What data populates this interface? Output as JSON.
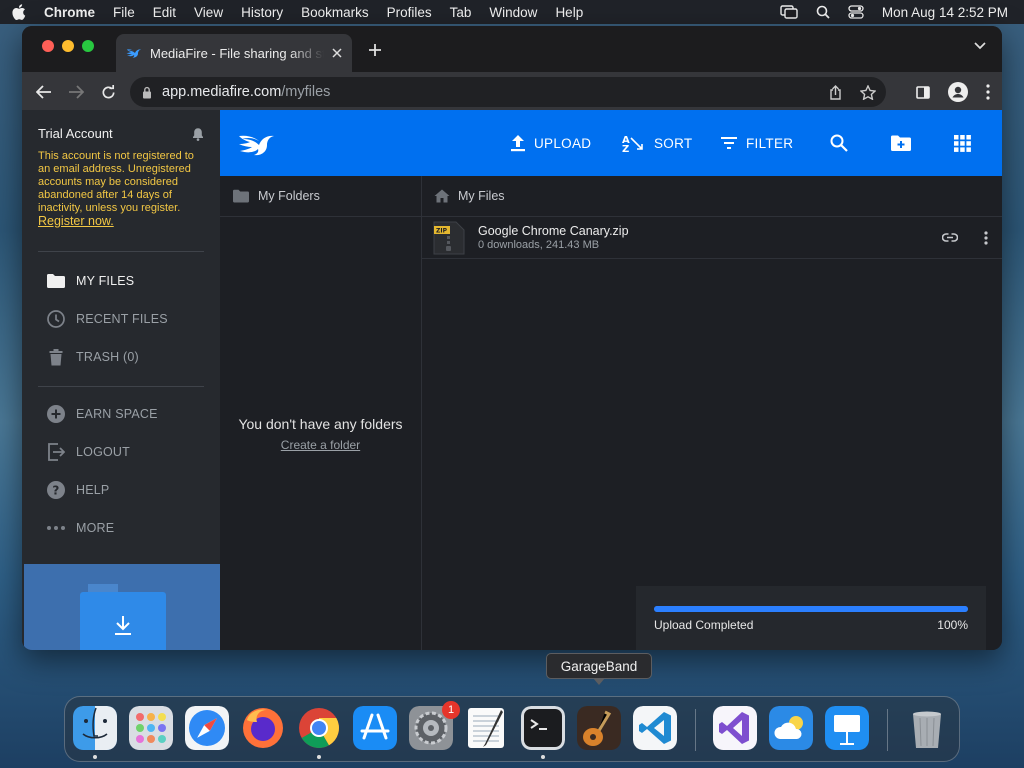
{
  "menubar": {
    "app": "Chrome",
    "items": [
      "File",
      "Edit",
      "View",
      "History",
      "Bookmarks",
      "Profiles",
      "Tab",
      "Window",
      "Help"
    ],
    "clock": "Mon Aug 14  2:52 PM"
  },
  "browser": {
    "tab_title": "MediaFire - File sharing and storage",
    "url_host": "app.mediafire.com",
    "url_path": "/myfiles"
  },
  "sidebar": {
    "account_title": "Trial Account",
    "warning": "This account is not registered to an email address. Unregistered accounts may be considered abandoned after 14 days of inactivity, unless you register.",
    "register_link": "Register now.",
    "items": [
      {
        "label": "MY FILES",
        "icon": "folder-icon"
      },
      {
        "label": "RECENT FILES",
        "icon": "clock-icon"
      },
      {
        "label": "TRASH (0)",
        "icon": "trash-icon"
      },
      {
        "label": "EARN SPACE",
        "icon": "plus-circle-icon"
      },
      {
        "label": "LOGOUT",
        "icon": "logout-icon"
      },
      {
        "label": "HELP",
        "icon": "help-icon"
      },
      {
        "label": "MORE",
        "icon": "more-icon"
      }
    ]
  },
  "header": {
    "upload": "UPLOAD",
    "sort": "SORT",
    "filter": "FILTER",
    "accent": "#0070f0"
  },
  "folders": {
    "title": "My Folders",
    "empty_message": "You don't have any folders",
    "create_link": "Create a folder"
  },
  "files": {
    "title": "My Files",
    "items": [
      {
        "name": "Google Chrome Canary.zip",
        "meta": "0 downloads, 241.43 MB",
        "type": "ZIP"
      }
    ]
  },
  "upload_status": {
    "label": "Upload Completed",
    "percent_text": "100%",
    "progress": 1.0
  },
  "dock": {
    "tooltip": "GarageBand",
    "settings_badge": "1",
    "apps": [
      "Finder",
      "Launchpad",
      "Safari",
      "Firefox",
      "Chrome",
      "App Store",
      "System Settings",
      "TextEdit",
      "Terminal",
      "GarageBand",
      "VS Code",
      "Visual Studio",
      "Weather",
      "Keynote",
      "Trash"
    ]
  }
}
